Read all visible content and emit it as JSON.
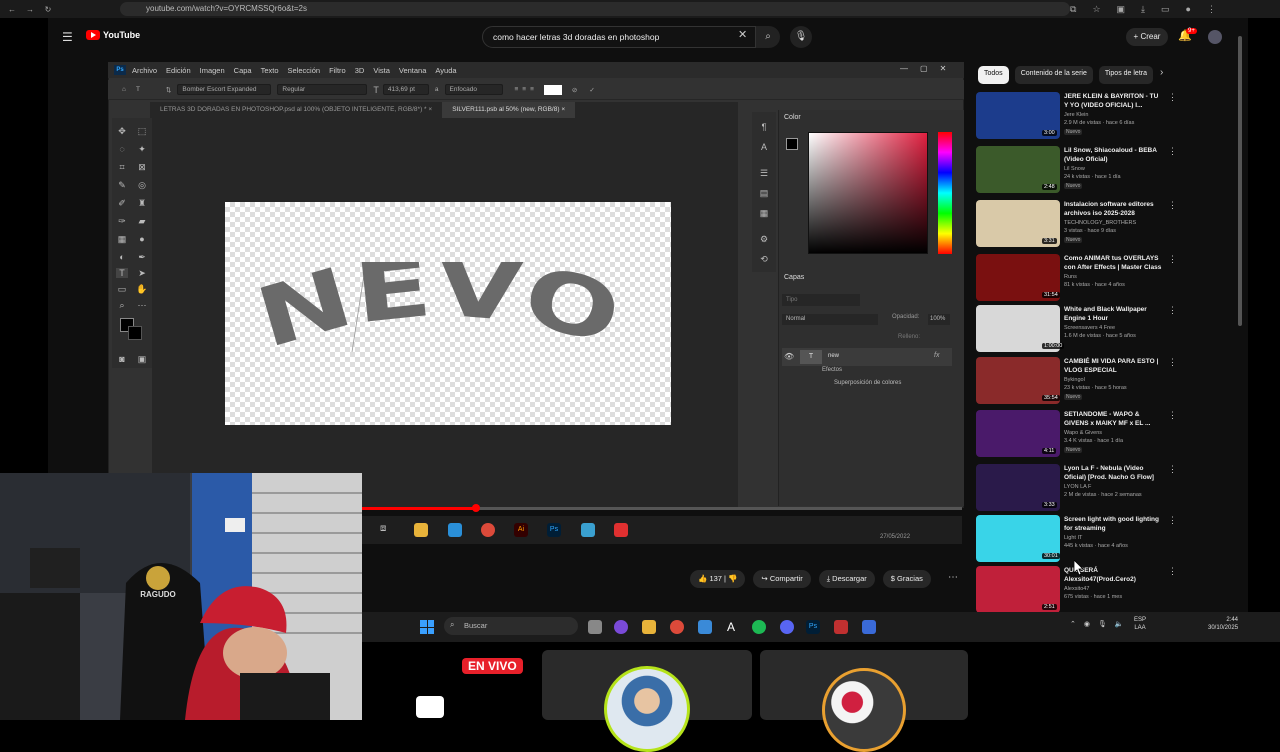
{
  "browser": {
    "url": "youtube.com/watch?v=OYRCMSSQr6o&t=2s"
  },
  "youtube": {
    "logo_text": "YouTube",
    "search_query": "como hacer letras 3d doradas en photoshop",
    "create_label": "Crear",
    "notifications_badge": "9+",
    "actions": {
      "likes": "137",
      "share": "Compartir",
      "download": "Descargar",
      "thanks": "Gracias"
    },
    "chips": [
      "Todos",
      "Contenido de la serie",
      "Tipos de letra"
    ],
    "recommendations": [
      {
        "title": "JERE KLEIN & BAYRITON - TU Y YO (VIDEO OFICIAL) I...",
        "channel": "Jere Klein",
        "views": "2.9 M de vistas · hace 6 días",
        "badge": "Nuevo",
        "duration": "3:00",
        "color": "#1c3c8c"
      },
      {
        "title": "Lil Snow, Shiacoaloud - BEBA (Video Oficial)",
        "channel": "Lil Snow",
        "views": "24 k vistas · hace 1 día",
        "badge": "Nuevo",
        "duration": "2:48",
        "color": "#3b5a2a"
      },
      {
        "title": "Instalacion software editores archivos iso 2025-2028",
        "channel": "TECHNOLOGY_BROTHERS",
        "views": "3 vistas · hace 9 días",
        "badge": "Nuevo",
        "duration": "3:31",
        "color": "#d9c9a8"
      },
      {
        "title": "Como ANIMAR tus OVERLAYS con After Effects | Master Class",
        "channel": "Runs",
        "views": "81 k vistas · hace 4 años",
        "badge": "",
        "duration": "31:54",
        "color": "#7a1010"
      },
      {
        "title": "White and Black Wallpaper Engine 1 Hour",
        "channel": "Screensavers 4 Free",
        "views": "1.6 M de vistas · hace 5 años",
        "badge": "",
        "duration": "1:00:00",
        "color": "#d8d8d8"
      },
      {
        "title": "CAMBIÉ MI VIDA PARA ESTO | VLOG ESPECIAL",
        "channel": "Bykingol",
        "views": "23 k vistas · hace 5 horas",
        "badge": "Nuevo",
        "duration": "35:54",
        "color": "#8a2a2a"
      },
      {
        "title": "SETIANDOME - WAPO & GIVENS x MAIKY MF x EL ...",
        "channel": "Wapo & Givens",
        "views": "3.4 K vistas · hace 1 día",
        "badge": "Nuevo",
        "duration": "4:11",
        "color": "#4a1a6a"
      },
      {
        "title": "Lyon La F - Nebula (Video Oficial) [Prod. Nacho G Flow]",
        "channel": "LYON LA F",
        "views": "2 M de vistas · hace 2 semanas",
        "badge": "",
        "duration": "3:33",
        "color": "#2a1a4a"
      },
      {
        "title": "Screen light with good lighting for streaming",
        "channel": "Light IT",
        "views": "445 k vistas · hace 4 años",
        "badge": "",
        "duration": "30:01",
        "color": "#39d4e8"
      },
      {
        "title": "QUÉ SERÁ Alexsito47(Prod.Cero2)",
        "channel": "Alexsito47",
        "views": "675 vistas · hace 1 mes",
        "badge": "",
        "duration": "2:51",
        "color": "#c0203a"
      }
    ]
  },
  "photoshop": {
    "logo": "Ps",
    "menu": [
      "Archivo",
      "Edición",
      "Imagen",
      "Capa",
      "Texto",
      "Selección",
      "Filtro",
      "3D",
      "Vista",
      "Ventana",
      "Ayuda"
    ],
    "options": {
      "font": "Bomber Escort Expanded",
      "style": "Regular",
      "size": "413,69 pt",
      "aa": "Enfocado"
    },
    "tabs": [
      {
        "label": "LETRAS 3D DORADAS EN PHOTOSHOP.psd al 100% (OBJETO INTELIGENTE, RGB/8*) *",
        "active": false
      },
      {
        "label": "SILVER111.psb al 50% (new, RGB/8)",
        "active": true
      }
    ],
    "canvas_text": "NEVO",
    "panels": {
      "color_label": "Color",
      "layers_label": "Capas",
      "search_placeholder": "Tipo",
      "blend_mode": "Normal",
      "opacity_label": "Opacidad:",
      "opacity_value": "100%",
      "fill_label": "Relleno:",
      "layer_name": "new",
      "layer_fx": "fx",
      "effects_label": "Efectos",
      "effect_1": "Superposición de colores"
    },
    "taskbar_date": "27/05/2022"
  },
  "windows": {
    "search_placeholder": "Buscar",
    "lang": "ESP",
    "lang_sub": "LAA",
    "time": "2:44",
    "date": "30/10/2025"
  },
  "stream": {
    "live_label": "EN VIVO",
    "chair_brand": "RAGUDO"
  }
}
